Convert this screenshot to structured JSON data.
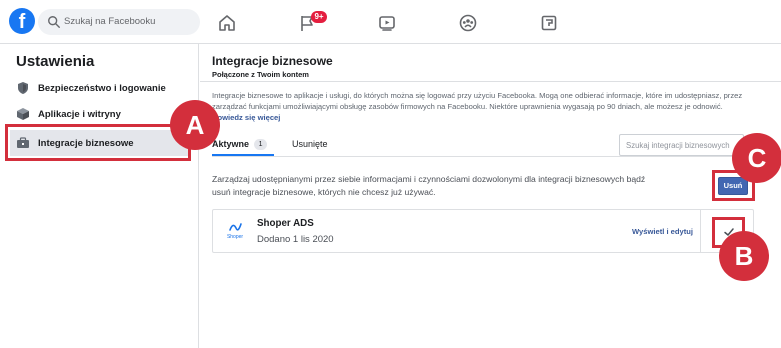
{
  "topbar": {
    "logo_letter": "f",
    "search_placeholder": "Szukaj na Facebooku",
    "notifications_badge": "9+",
    "icons": [
      "home-icon",
      "flag-icon",
      "video-icon",
      "groups-icon",
      "gaming-icon"
    ]
  },
  "sidebar": {
    "title": "Ustawienia",
    "items": [
      {
        "label": "Bezpieczeństwo i logowanie",
        "icon": "shield-icon"
      },
      {
        "label": "Aplikacje i witryny",
        "icon": "cube-icon"
      },
      {
        "label": "Integracje biznesowe",
        "icon": "briefcase-icon",
        "active": true
      }
    ]
  },
  "main": {
    "title": "Integracje biznesowe",
    "subtitle": "Połączone z Twoim kontem",
    "description": "Integracje biznesowe to aplikacje i usługi, do których można się logować przy użyciu Facebooka. Mogą one odbierać informacje, które im udostępniasz, przez zarządzać funkcjami umożliwiającymi obsługę zasobów firmowych na Facebooku. Niektóre uprawnienia wygasają po 90 dniach, ale możesz je odnowić.",
    "learn_more": "Dowiedz się więcej",
    "tabs": [
      {
        "label": "Aktywne",
        "count": "1",
        "active": true
      },
      {
        "label": "Usunięte"
      }
    ],
    "search_placeholder": "Szukaj integracji biznesowych",
    "manage_text": "Zarządzaj udostępnianymi przez siebie informacjami i czynnościami dozwolonymi dla integracji biznesowych bądź usuń integracje biznesowe, których nie chcesz już używać.",
    "remove_label": "Usuń",
    "integration": {
      "name": "Shoper ADS",
      "date": "Dodano 1 lis 2020",
      "logo_text": "Shoper",
      "view_edit": "Wyświetl i edytuj"
    }
  },
  "callouts": [
    "A",
    "B",
    "C"
  ],
  "colors": {
    "brand": "#1877f2",
    "highlight": "#d32f3c",
    "button": "#4267b2",
    "link": "#385898"
  }
}
